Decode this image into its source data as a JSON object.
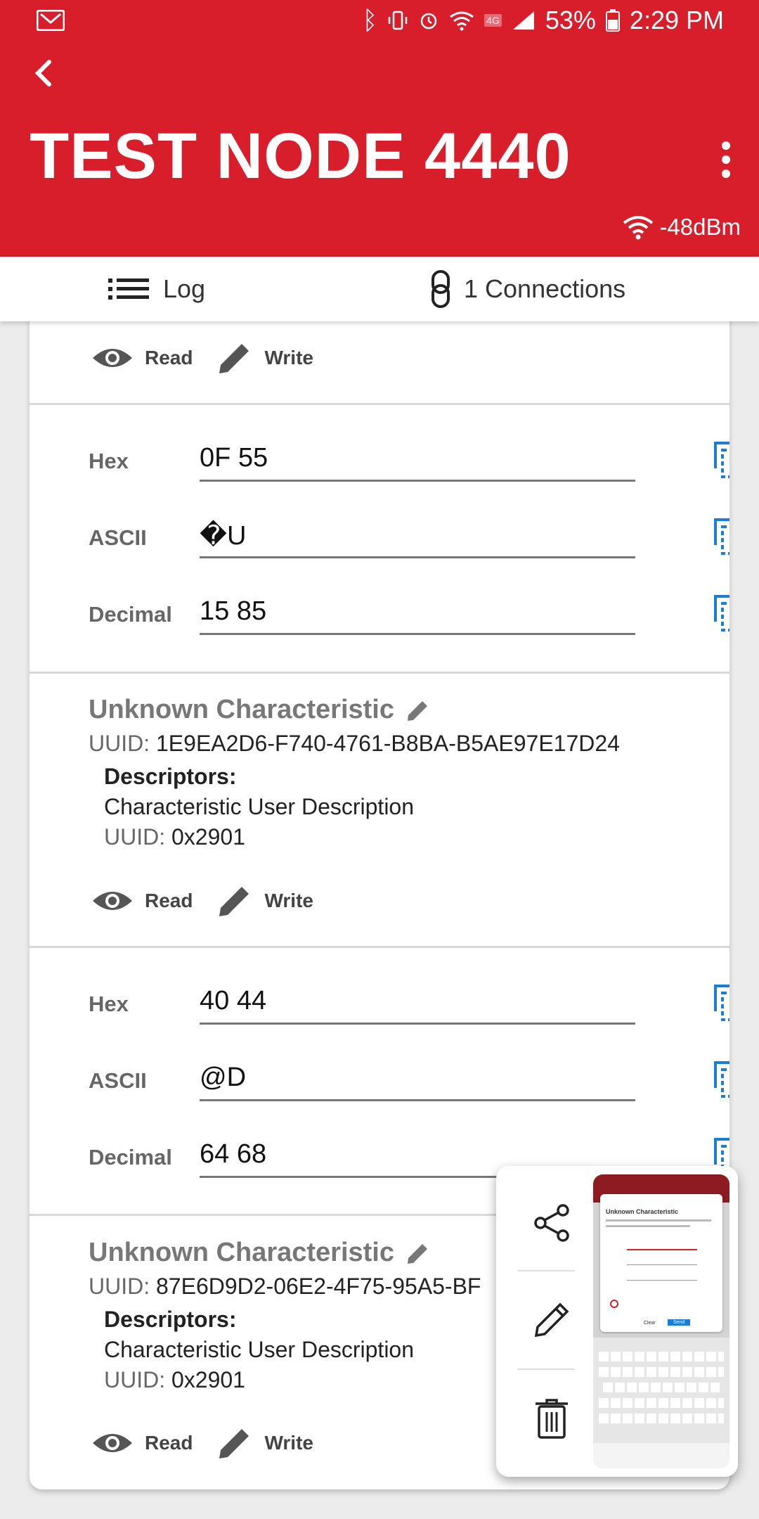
{
  "status_bar": {
    "battery": "53%",
    "time": "2:29 PM",
    "network": "4G"
  },
  "header": {
    "title": "TEST NODE 4440",
    "rssi": "-48dBm"
  },
  "tabs": {
    "log": "Log",
    "connections": "1 Connections"
  },
  "actions": {
    "read": "Read",
    "write": "Write"
  },
  "values1": {
    "hex_label": "Hex",
    "hex": "0F 55",
    "ascii_label": "ASCII",
    "ascii": "�U",
    "decimal_label": "Decimal",
    "decimal": "15 85"
  },
  "char1": {
    "name": "Unknown Characteristic",
    "uuid_label": "UUID:",
    "uuid": "1E9EA2D6-F740-4761-B8BA-B5AE97E17D24",
    "descriptors_label": "Descriptors:",
    "descriptor_name": "Characteristic User Description",
    "descriptor_uuid_label": "UUID:",
    "descriptor_uuid": "0x2901"
  },
  "values2": {
    "hex_label": "Hex",
    "hex": "40 44",
    "ascii_label": "ASCII",
    "ascii": "@D",
    "decimal_label": "Decimal",
    "decimal": "64 68"
  },
  "char2": {
    "name": "Unknown Characteristic",
    "uuid_label": "UUID:",
    "uuid": "87E6D9D2-06E2-4F75-95A5-BF",
    "descriptors_label": "Descriptors:",
    "descriptor_name": "Characteristic User Description",
    "descriptor_uuid_label": "UUID:",
    "descriptor_uuid": "0x2901"
  },
  "screenshot_popup": {
    "thumb_title": "Unknown Characteristic",
    "thumb_send": "Send",
    "thumb_clear": "Clear"
  },
  "colors": {
    "brand_red": "#d81e2b",
    "copy_blue": "#1a7fd4"
  }
}
